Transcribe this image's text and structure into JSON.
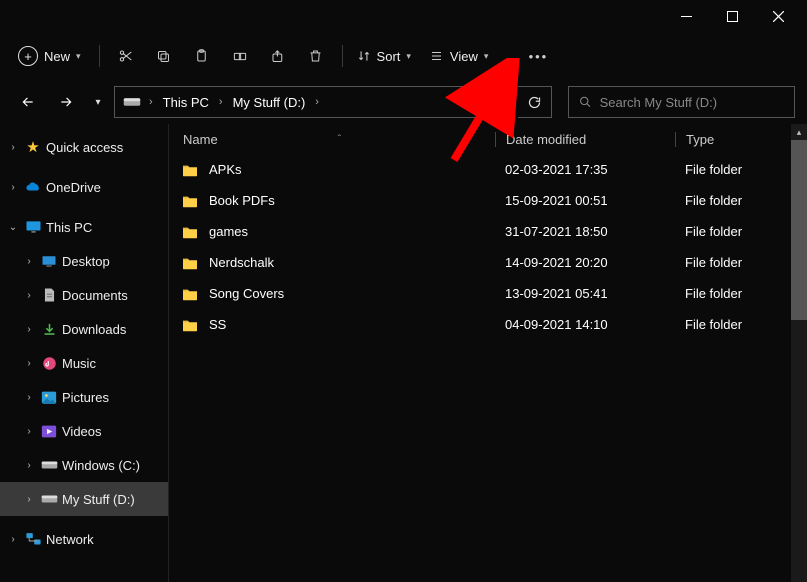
{
  "titlebar": {},
  "toolbar": {
    "new_label": "New",
    "sort_label": "Sort",
    "view_label": "View"
  },
  "addressbar": {
    "crumb1": "This PC",
    "crumb2": "My Stuff (D:)"
  },
  "search": {
    "placeholder": "Search My Stuff (D:)"
  },
  "columns": {
    "name": "Name",
    "date": "Date modified",
    "type": "Type"
  },
  "files": [
    {
      "name": "APKs",
      "date": "02-03-2021 17:35",
      "type": "File folder"
    },
    {
      "name": "Book PDFs",
      "date": "15-09-2021 00:51",
      "type": "File folder"
    },
    {
      "name": "games",
      "date": "31-07-2021 18:50",
      "type": "File folder"
    },
    {
      "name": "Nerdschalk",
      "date": "14-09-2021 20:20",
      "type": "File folder"
    },
    {
      "name": "Song Covers",
      "date": "13-09-2021 05:41",
      "type": "File folder"
    },
    {
      "name": "SS",
      "date": "04-09-2021 14:10",
      "type": "File folder"
    }
  ],
  "sidebar": {
    "quick_access": "Quick access",
    "onedrive": "OneDrive",
    "this_pc": "This PC",
    "desktop": "Desktop",
    "documents": "Documents",
    "downloads": "Downloads",
    "music": "Music",
    "pictures": "Pictures",
    "videos": "Videos",
    "windows_c": "Windows (C:)",
    "my_stuff_d": "My Stuff (D:)",
    "network": "Network"
  }
}
